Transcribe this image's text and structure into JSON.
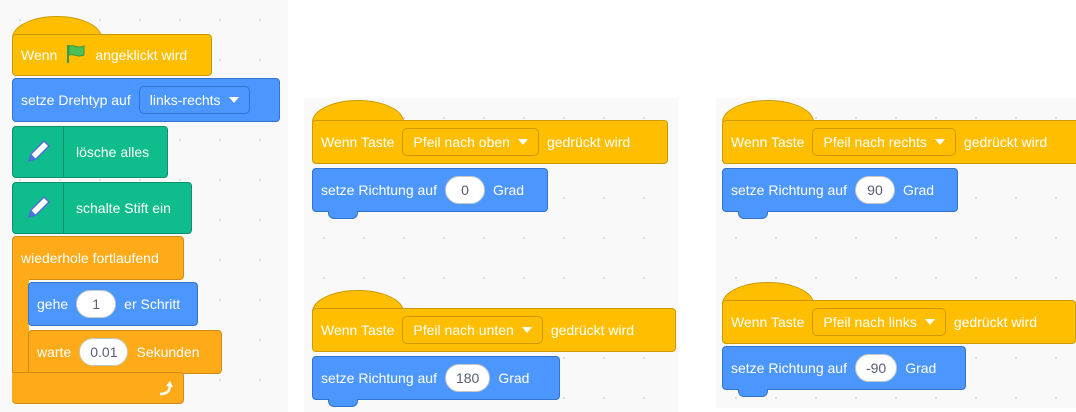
{
  "script1": {
    "when_flag": {
      "prefix": "Wenn",
      "suffix": "angeklickt wird",
      "icon": "green-flag-icon",
      "flag_color": "#4cbf56"
    },
    "set_rotation": {
      "label": "setze Drehtyp auf",
      "value": "links-rechts"
    },
    "clear": {
      "label": "lösche alles",
      "icon": "pen-icon"
    },
    "pen_down": {
      "label": "schalte Stift ein",
      "icon": "pen-icon"
    },
    "forever": {
      "label": "wiederhole fortlaufend",
      "loop_icon": "loop-arrow-icon"
    },
    "move": {
      "prefix": "gehe",
      "value": "1",
      "suffix": "er Schritt"
    },
    "wait": {
      "prefix": "warte",
      "value": "0.01",
      "suffix": "Sekunden"
    }
  },
  "scripts": [
    {
      "hat_prefix": "Wenn Taste",
      "key": "Pfeil nach oben",
      "hat_suffix": "gedrückt wird",
      "set_label": "setze Richtung auf",
      "value": "0",
      "unit": "Grad"
    },
    {
      "hat_prefix": "Wenn Taste",
      "key": "Pfeil nach unten",
      "hat_suffix": "gedrückt wird",
      "set_label": "setze Richtung auf",
      "value": "180",
      "unit": "Grad"
    },
    {
      "hat_prefix": "Wenn Taste",
      "key": "Pfeil nach rechts",
      "hat_suffix": "gedrückt wird",
      "set_label": "setze Richtung auf",
      "value": "90",
      "unit": "Grad"
    },
    {
      "hat_prefix": "Wenn Taste",
      "key": "Pfeil nach links",
      "hat_suffix": "gedrückt wird",
      "set_label": "setze Richtung auf",
      "value": "-90",
      "unit": "Grad"
    }
  ],
  "colors": {
    "events": "#ffbf00",
    "motion": "#4c97ff",
    "pen": "#0fbd8c",
    "control": "#ffab19",
    "canvas": "#f9f9f9"
  }
}
